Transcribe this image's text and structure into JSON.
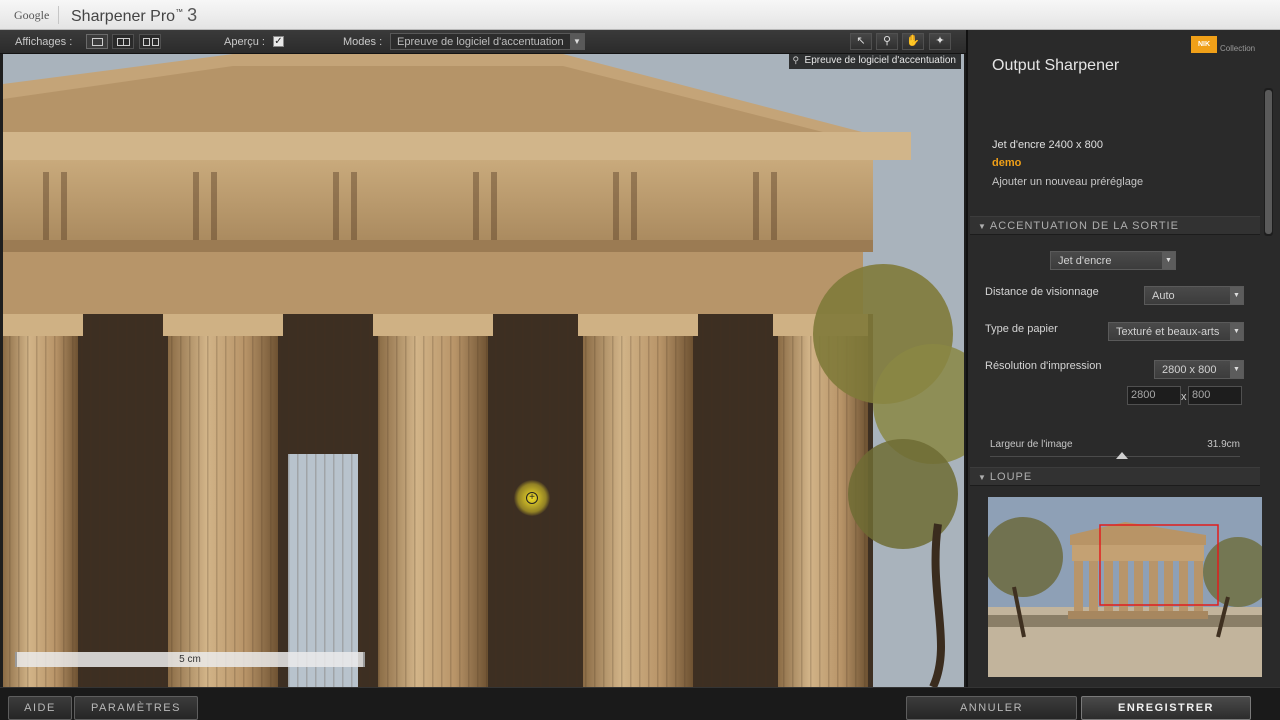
{
  "window": {
    "brand": "Google",
    "app_name": "Sharpener Pro",
    "trademark": "™",
    "version": "3"
  },
  "toolbar": {
    "views_label": "Affichages :",
    "preview_label": "Aperçu :",
    "preview_checked": true,
    "modes_label": "Modes :",
    "mode_value": "Epreuve de logiciel d'accentuation",
    "tools": [
      "pointer-icon",
      "zoom-icon",
      "hand-icon",
      "pin-icon"
    ]
  },
  "preview": {
    "overlay_label": "Epreuve de logiciel d'accentuation",
    "ruler_label": "5 cm"
  },
  "panel": {
    "title": "Output Sharpener",
    "brand_badge": "NIK",
    "brand_collection": "Collection",
    "presets": [
      {
        "label": "Jet d'encre 2400 x 800",
        "color": "#e0e0e0"
      },
      {
        "label": "demo",
        "color": "#f0a018"
      },
      {
        "label": "Ajouter un nouveau préréglage",
        "color": "#c6c6c6"
      }
    ],
    "output_section": {
      "title": "ACCENTUATION DE LA SORTIE",
      "printer_type": "Jet d'encre",
      "viewing_distance_label": "Distance de visionnage",
      "viewing_distance_value": "Auto",
      "paper_type_label": "Type de papier",
      "paper_type_value": "Texturé et beaux-arts",
      "resolution_label": "Résolution d'impression",
      "resolution_value": "2800 x 800",
      "res_x": "2800",
      "res_separator": "x",
      "res_y": "800",
      "image_width_label": "Largeur de l'image",
      "image_width_value": "31.9cm"
    },
    "loupe_section": {
      "title": "LOUPE"
    }
  },
  "bottom": {
    "help": "AIDE",
    "settings": "PARAMÈTRES",
    "cancel": "ANNULER",
    "save": "ENREGISTRER"
  },
  "colors": {
    "accent": "#f0a018",
    "stone": "#c3a377",
    "sky": "#a9b3bc"
  }
}
